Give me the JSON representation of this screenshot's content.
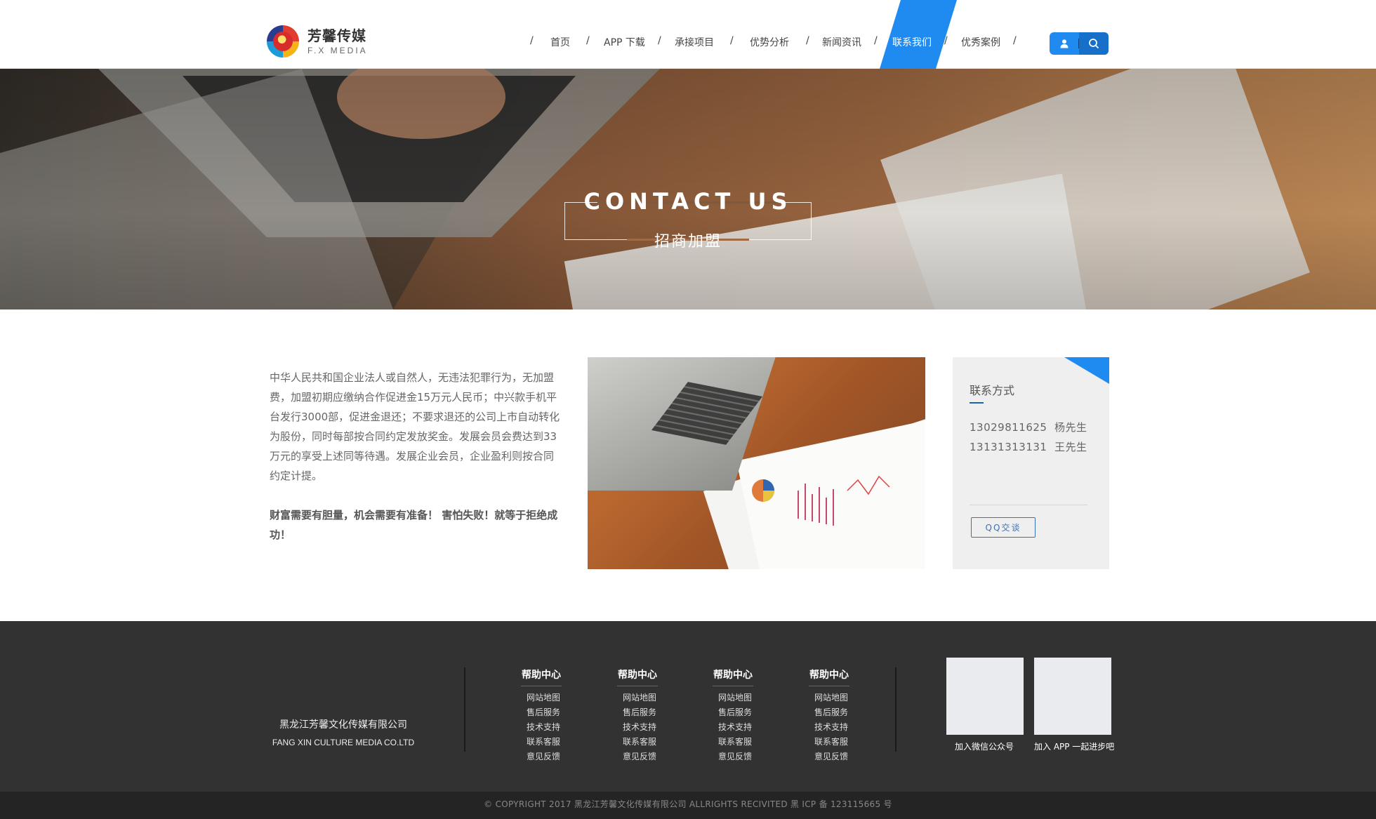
{
  "header": {
    "logo": {
      "cn": "芳馨传媒",
      "en": "F.X MEDIA"
    },
    "nav": [
      {
        "label": "首页"
      },
      {
        "label": "APP 下载"
      },
      {
        "label": "承接项目"
      },
      {
        "label": "优势分析"
      },
      {
        "label": "新闻资讯"
      },
      {
        "label": "联系我们",
        "active": true
      },
      {
        "label": "优秀案例"
      }
    ],
    "separator": "/",
    "icons": [
      "user-icon",
      "search-icon"
    ]
  },
  "banner": {
    "title_en": "CONTACT US",
    "title_cn": "招商加盟"
  },
  "main": {
    "paragraph": "中华人民共和国企业法人或自然人，无违法犯罪行为，无加盟费，加盟初期应缴纳合作促进金15万元人民币；中兴款手机平台发行3000部，促进金退还；不要求退还的公司上市自动转化为股份，同时每部按合同约定发放奖金。发展会员会费达到33万元的享受上述同等待遇。发展企业会员，企业盈利则按合同约定计提。",
    "slogan": "财富需要有胆量，机会需要有准备！ 害怕失败！就等于拒绝成功！"
  },
  "contact_card": {
    "title": "联系方式",
    "phones": [
      {
        "number": "13029811625",
        "name": "杨先生"
      },
      {
        "number": "13131313131",
        "name": "王先生"
      }
    ],
    "qq_button": "QQ交谈"
  },
  "footer": {
    "company_cn": "黑龙江芳馨文化传媒有限公司",
    "company_en": "FANG XIN CULTURE MEDIA CO.LTD",
    "help_columns": [
      {
        "title": "帮助中心",
        "links": [
          "网站地图",
          "售后服务",
          "技术支持",
          "联系客服",
          "意见反馈"
        ]
      },
      {
        "title": "帮助中心",
        "links": [
          "网站地图",
          "售后服务",
          "技术支持",
          "联系客服",
          "意见反馈"
        ]
      },
      {
        "title": "帮助中心",
        "links": [
          "网站地图",
          "售后服务",
          "技术支持",
          "联系客服",
          "意见反馈"
        ]
      },
      {
        "title": "帮助中心",
        "links": [
          "网站地图",
          "售后服务",
          "技术支持",
          "联系客服",
          "意见反馈"
        ]
      }
    ],
    "qr": [
      {
        "caption": "加入微信公众号"
      },
      {
        "caption": "加入 APP 一起进步吧"
      }
    ],
    "copyright": "© COPYRIGHT 2017 黑龙江芳馨文化传媒有限公司 ALLRIGHTS RECIVITED 黑 ICP 备 123115665 号"
  },
  "colors": {
    "accent": "#1f8af0",
    "footer_bg": "#323232",
    "copyright_bg": "#242424"
  }
}
